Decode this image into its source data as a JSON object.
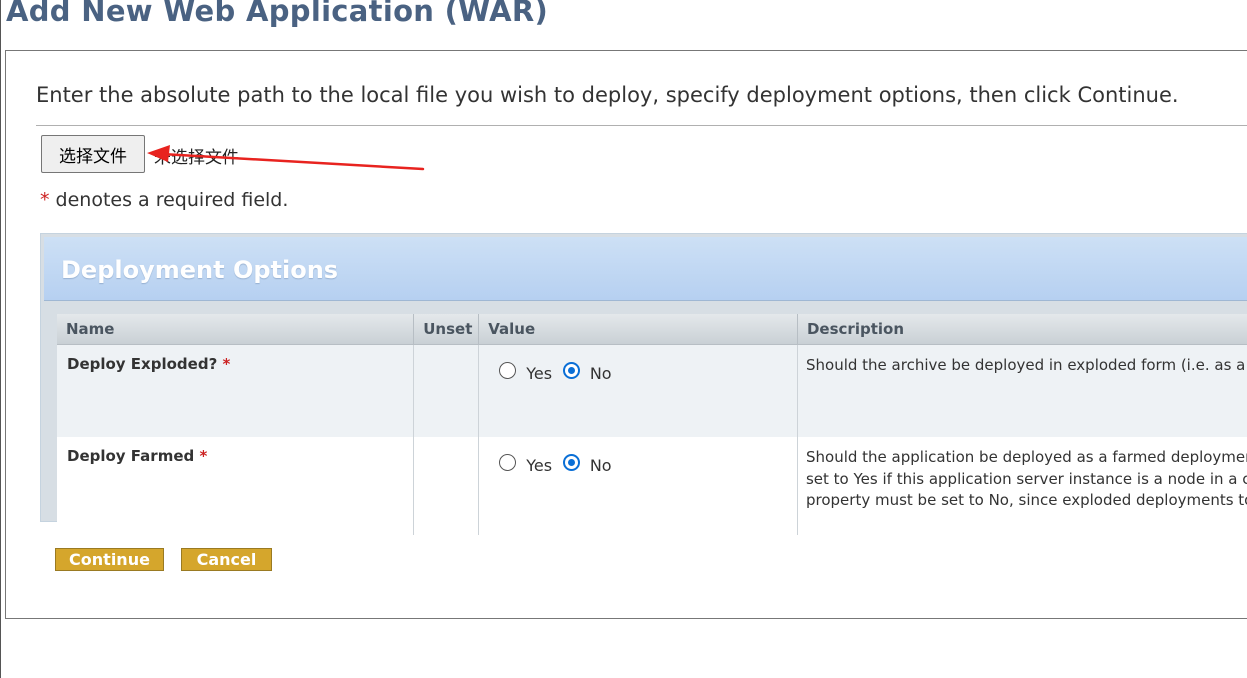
{
  "page": {
    "title": "Add New Web Application (WAR)",
    "instructions": "Enter the absolute path to the local file you wish to deploy, specify deployment options, then click Continue."
  },
  "file_input": {
    "button_label": "选择文件",
    "status": "未选择文件"
  },
  "annotation": {
    "arrow_color": "#e8231f"
  },
  "required_note": {
    "asterisk": "*",
    "text": "denotes a required field."
  },
  "options": {
    "title": "Deployment Options",
    "columns": [
      "Name",
      "Unset",
      "Value",
      "Description"
    ],
    "rows": [
      {
        "name": "Deploy Exploded?",
        "required": "*",
        "yes_label": "Yes",
        "no_label": "No",
        "selected": "No",
        "description": [
          "Should the archive be deployed in exploded form (i.e. as a"
        ]
      },
      {
        "name": "Deploy Farmed",
        "required": "*",
        "yes_label": "Yes",
        "no_label": "No",
        "selected": "No",
        "description": [
          "Should the application be deployed as a farmed deploymer",
          "set to Yes if this application server instance is a node in a c",
          "property must be set to No, since exploded deployments to"
        ]
      }
    ]
  },
  "actions": {
    "continue_label": "Continue",
    "cancel_label": "Cancel"
  },
  "colors": {
    "title": "#4a6282",
    "button_gold": "#d5a62c",
    "radio_checked": "#0a6fd6",
    "required": "#cc2222"
  }
}
